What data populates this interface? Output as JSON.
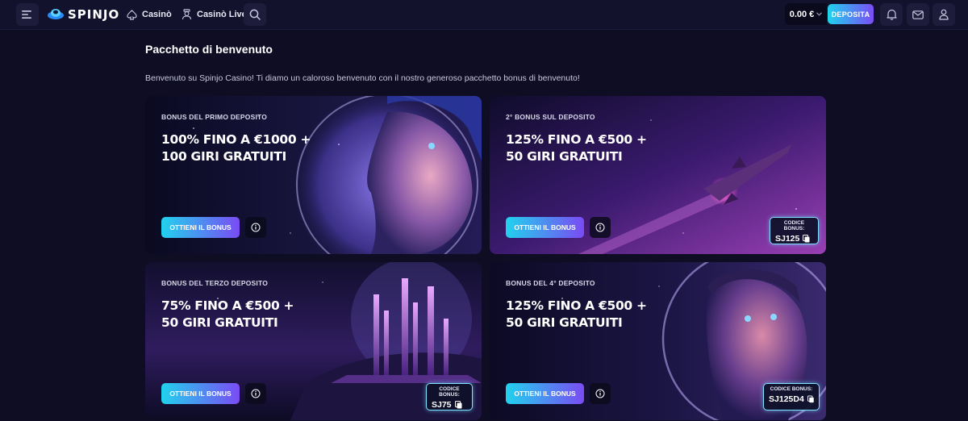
{
  "header": {
    "logo_text": "SPINJO",
    "nav": [
      {
        "label": "Casinò",
        "icon": "spade-icon"
      },
      {
        "label": "Casinò Live",
        "icon": "dealer-icon"
      }
    ],
    "balance": "0.00 €",
    "deposit_label": "DEPOSITA",
    "icons": [
      "menu-icon",
      "search-icon",
      "bell-icon",
      "mail-icon",
      "user-icon"
    ]
  },
  "main": {
    "title": "Pacchetto di benvenuto",
    "intro": "Benvenuto su Spinjo Casino! Ti diamo un caloroso benvenuto con il nostro generoso pacchetto bonus di benvenuto!",
    "cards": [
      {
        "label": "BONUS DEL PRIMO DEPOSITO",
        "title_line1": "100% FINO A €1000 +",
        "title_line2": "100 GIRI GRATUITI",
        "button": "OTTIENI IL BONUS",
        "code_label": "",
        "code": ""
      },
      {
        "label": "2° BONUS SUL DEPOSITO",
        "title_line1": "125% FINO A €500 +",
        "title_line2": "50 GIRI GRATUITI",
        "button": "OTTIENI IL BONUS",
        "code_label": "CODICE BONUS:",
        "code": "SJ125"
      },
      {
        "label": "BONUS DEL TERZO DEPOSITO",
        "title_line1": "75% FINO A €500 +",
        "title_line2": "50 GIRI GRATUITI",
        "button": "OTTIENI IL BONUS",
        "code_label": "CODICE BONUS:",
        "code": "SJ75"
      },
      {
        "label": "BONUS DEL 4° DEPOSITO",
        "title_line1": "125% FINO A €500 +",
        "title_line2": "50 GIRI GRATUITI",
        "button": "OTTIENI IL BONUS",
        "code_label": "CODICE BONUS:",
        "code": "SJ125D4"
      }
    ]
  },
  "colors": {
    "background": "#0e0d24",
    "header": "#13122d",
    "accent_start": "#1fd3ee",
    "accent_end": "#7b4cf5",
    "code_border": "#7fe0ff"
  }
}
